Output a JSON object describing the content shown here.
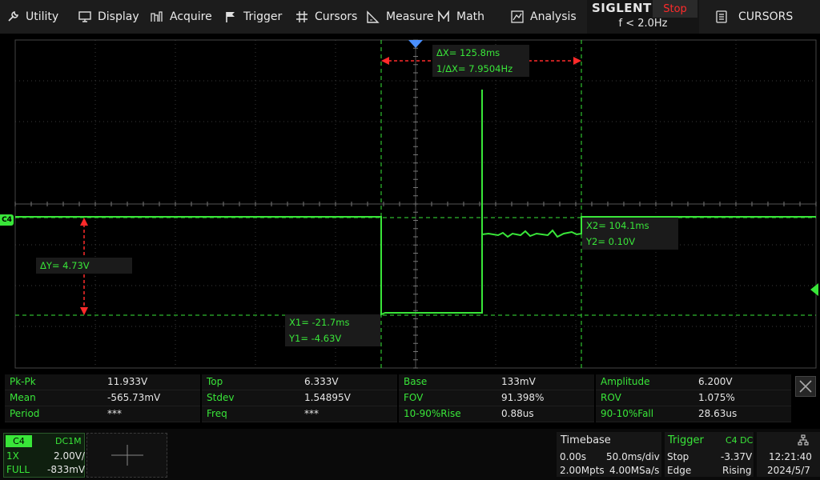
{
  "menu": {
    "utility": "Utility",
    "display": "Display",
    "acquire": "Acquire",
    "trigger": "Trigger",
    "cursors": "Cursors",
    "measure": "Measure",
    "math": "Math",
    "analysis": "Analysis"
  },
  "brand": "SIGLENT",
  "run_state": "Stop",
  "freq_info": "f < 2.0Hz",
  "cursors_panel_label": "CURSORS",
  "channel_marker": "C4",
  "cursor_readouts": {
    "delta_x": "ΔX= 125.8ms",
    "inv_delta_x": "1/ΔX= 7.9504Hz",
    "x2": "X2= 104.1ms",
    "y2": "Y2= 0.10V",
    "delta_y": "ΔY= 4.73V",
    "x1": "X1= -21.7ms",
    "y1": "Y1= -4.63V"
  },
  "measurements": [
    [
      {
        "label": "Pk-Pk",
        "value": "11.933V"
      },
      {
        "label": "Top",
        "value": "6.333V"
      },
      {
        "label": "Base",
        "value": "133mV"
      },
      {
        "label": "Amplitude",
        "value": "6.200V"
      }
    ],
    [
      {
        "label": "Mean",
        "value": "-565.73mV"
      },
      {
        "label": "Stdev",
        "value": "1.54895V"
      },
      {
        "label": "FOV",
        "value": "91.398%"
      },
      {
        "label": "ROV",
        "value": "1.075%"
      }
    ],
    [
      {
        "label": "Period",
        "value": "***"
      },
      {
        "label": "Freq",
        "value": "***"
      },
      {
        "label": "10-90%Rise",
        "value": "0.88us"
      },
      {
        "label": "90-10%Fall",
        "value": "28.63us"
      }
    ]
  ],
  "channel": {
    "name": "C4",
    "coupling": "DC1M",
    "probe": "1X",
    "scale": "2.00V/",
    "bandwidth": "FULL",
    "offset": "-833mV"
  },
  "timebase": {
    "title": "Timebase",
    "delay": "0.00s",
    "scale": "50.0ms/div",
    "memory": "2.00Mpts",
    "sample_rate": "4.00MSa/s"
  },
  "trigger": {
    "title": "Trigger",
    "source": "C4 DC",
    "state": "Stop",
    "level": "-3.37V",
    "type": "Edge",
    "slope": "Rising"
  },
  "clock": {
    "time": "12:21:40",
    "date": "2024/5/7"
  },
  "colors": {
    "trace": "#39e639",
    "cursor_x": "#ff2a2a",
    "menu_bg": "#1c1c1c",
    "stop": "#ff2a2a"
  }
}
